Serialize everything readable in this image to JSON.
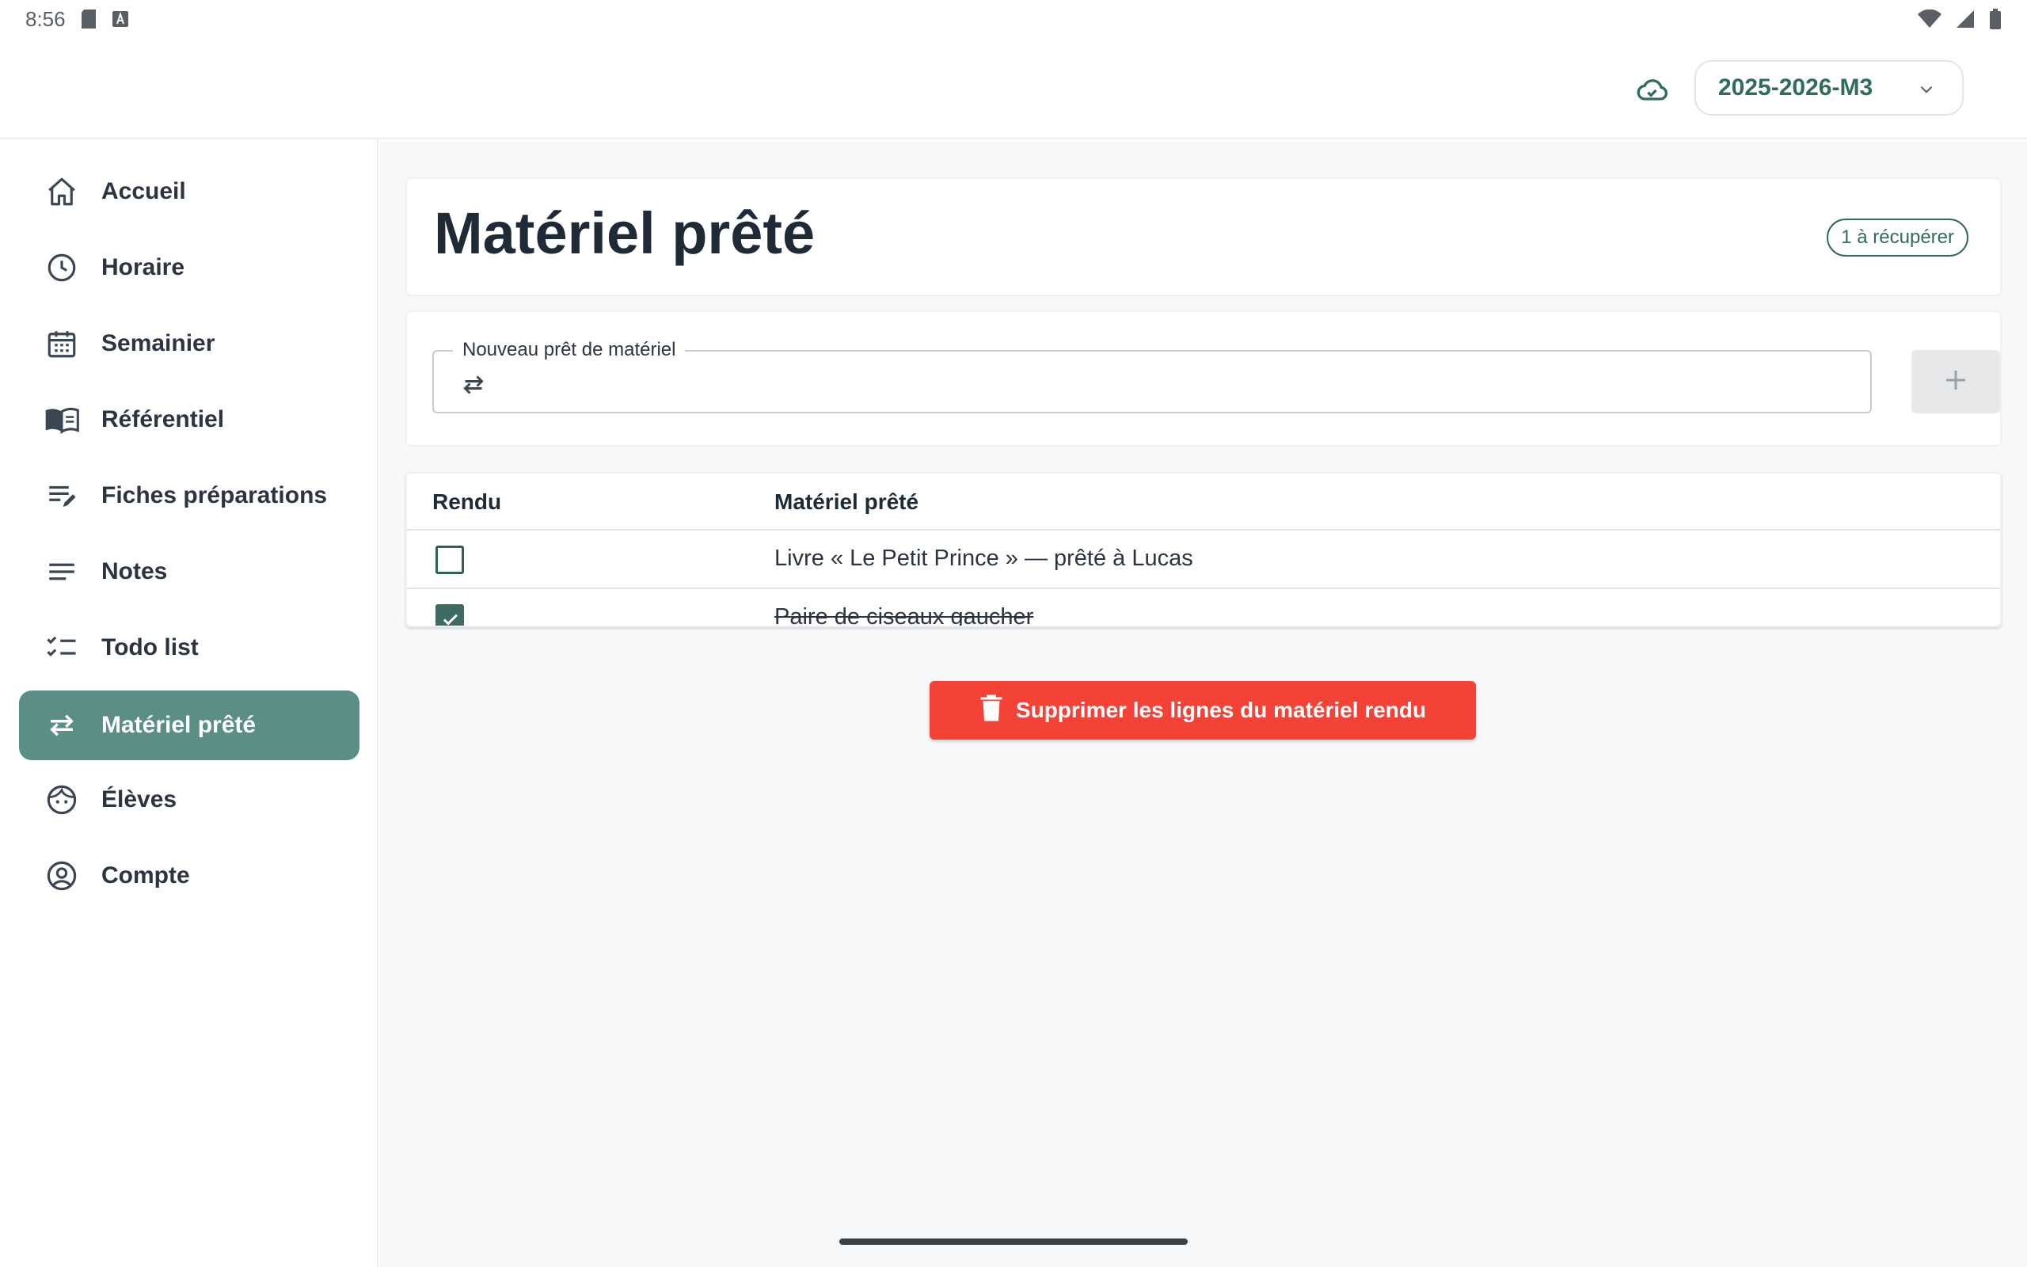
{
  "status_bar": {
    "time": "8:56"
  },
  "header": {
    "school_year": "2025-2026-M3"
  },
  "sidebar": {
    "items": [
      {
        "label": "Accueil",
        "icon": "home-icon"
      },
      {
        "label": "Horaire",
        "icon": "clock-icon"
      },
      {
        "label": "Semainier",
        "icon": "calendar-icon"
      },
      {
        "label": "Référentiel",
        "icon": "book-icon"
      },
      {
        "label": "Fiches préparations",
        "icon": "edit-note-icon"
      },
      {
        "label": "Notes",
        "icon": "notes-icon"
      },
      {
        "label": "Todo list",
        "icon": "checklist-icon"
      },
      {
        "label": "Matériel prêté",
        "icon": "swap-icon",
        "active": true
      },
      {
        "label": "Élèves",
        "icon": "face-icon"
      },
      {
        "label": "Compte",
        "icon": "account-icon"
      }
    ]
  },
  "main": {
    "title": "Matériel prêté",
    "badge": "1 à récupérer",
    "new_loan_label": "Nouveau prêt de matériel",
    "new_loan_value": "",
    "table": {
      "headers": {
        "returned": "Rendu",
        "item": "Matériel prêté"
      },
      "rows": [
        {
          "text": "Livre « Le Petit Prince » — prêté à Lucas",
          "returned": false
        },
        {
          "text": "Paire de ciseaux gaucher",
          "returned": true
        }
      ]
    },
    "delete_button": "Supprimer les lignes du matériel rendu"
  },
  "colors": {
    "accent": "#5b8f86",
    "accent_dark": "#2f6b5e",
    "danger": "#f44336"
  }
}
